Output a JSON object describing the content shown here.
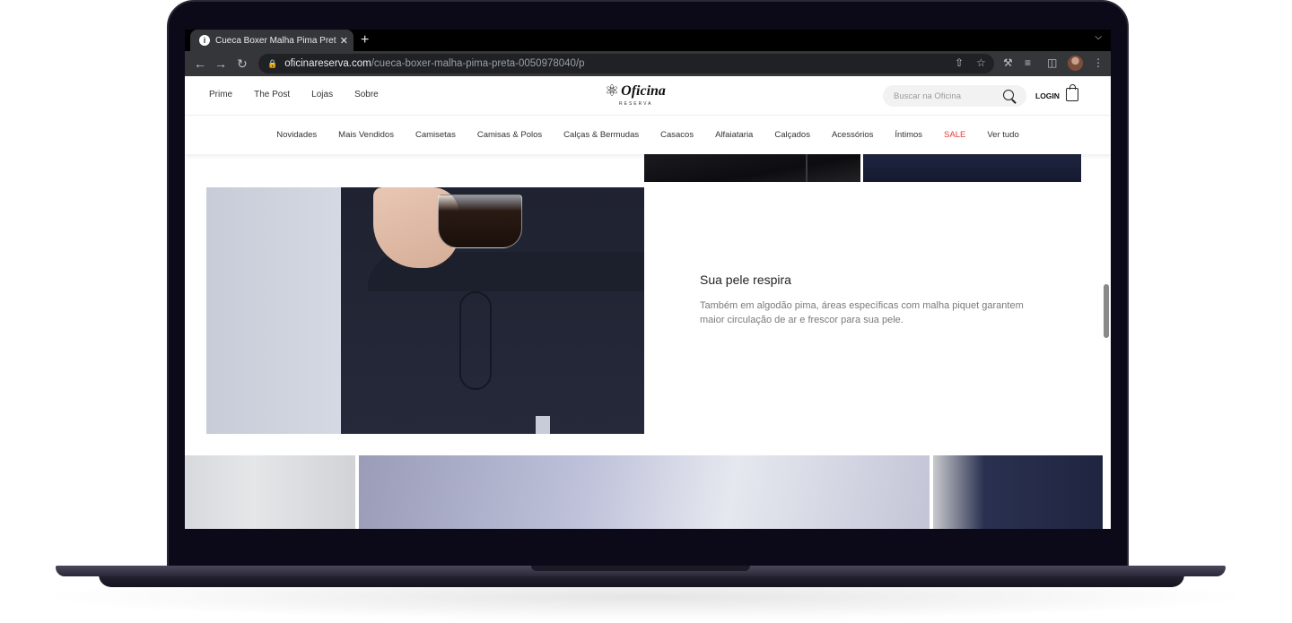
{
  "browser": {
    "tab_title": "Cueca Boxer Malha Pima Preta",
    "tab_close": "✕",
    "new_tab": "+",
    "url_host": "oficinareserva.com",
    "url_path": "/cueca-boxer-malha-pima-preta-0050978040/p"
  },
  "header": {
    "top_links": [
      "Prime",
      "The Post",
      "Lojas",
      "Sobre"
    ],
    "logo_text": "Oficina",
    "logo_sub": "RESERVA",
    "search_placeholder": "Buscar na Oficina",
    "login_label": "LOGIN"
  },
  "nav": {
    "items": [
      "Novidades",
      "Mais Vendidos",
      "Camisetas",
      "Camisas & Polos",
      "Calças & Bermudas",
      "Casacos",
      "Alfaiataria",
      "Calçados",
      "Acessórios",
      "Íntimos",
      "SALE",
      "Ver tudo"
    ]
  },
  "feature": {
    "title": "Sua pele respira",
    "description": "Também em algodão pima, áreas específicas com malha piquet garantem maior circulação de ar e frescor para sua pele."
  },
  "colors": {
    "sale": "#e53935",
    "browser_dark": "#35363a",
    "omnibox": "#202124"
  }
}
